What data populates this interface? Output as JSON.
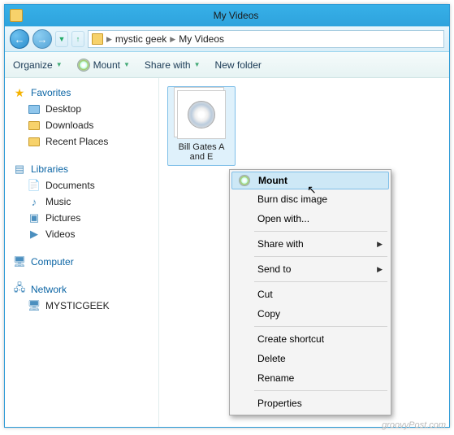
{
  "window": {
    "title": "My Videos"
  },
  "breadcrumb": {
    "seg1": "mystic geek",
    "seg2": "My Videos"
  },
  "toolbar": {
    "organize": "Organize",
    "mount": "Mount",
    "share": "Share with",
    "newfolder": "New folder"
  },
  "sidebar": {
    "favorites": {
      "label": "Favorites",
      "items": [
        "Desktop",
        "Downloads",
        "Recent Places"
      ]
    },
    "libraries": {
      "label": "Libraries",
      "items": [
        "Documents",
        "Music",
        "Pictures",
        "Videos"
      ]
    },
    "computer": {
      "label": "Computer"
    },
    "network": {
      "label": "Network",
      "items": [
        "MYSTICGEEK"
      ]
    }
  },
  "file": {
    "name": "Bill Gates A and E"
  },
  "context_menu": {
    "mount": "Mount",
    "burn": "Burn disc image",
    "openwith": "Open with...",
    "sharewith": "Share with",
    "sendto": "Send to",
    "cut": "Cut",
    "copy": "Copy",
    "shortcut": "Create shortcut",
    "delete": "Delete",
    "rename": "Rename",
    "properties": "Properties"
  },
  "watermark": "groovyPost.com"
}
